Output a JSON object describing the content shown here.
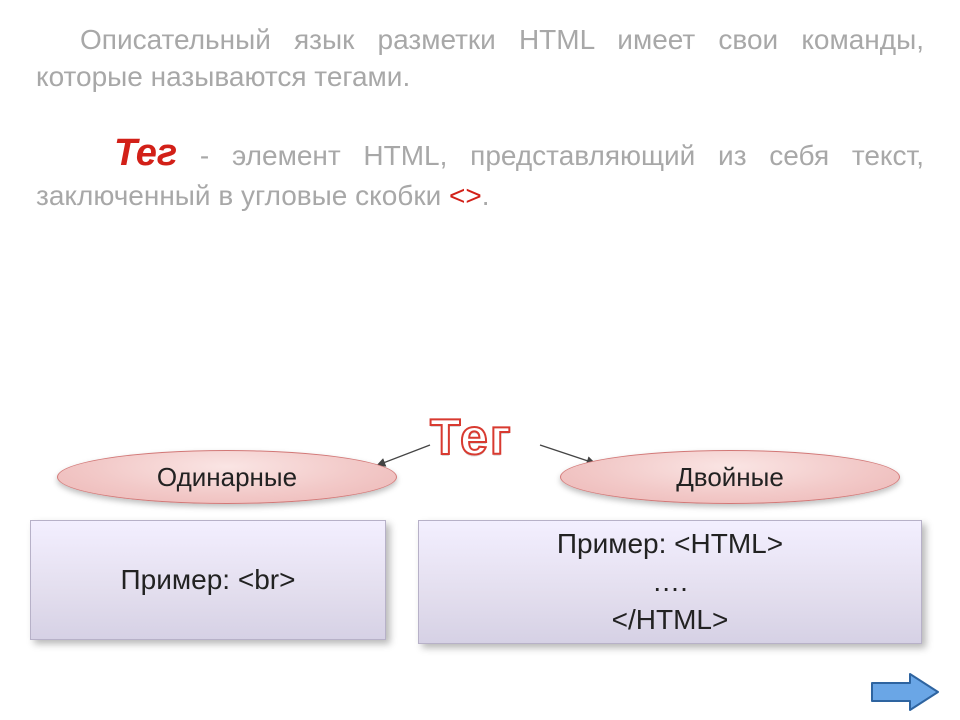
{
  "paragraph1": "Описательный язык разметки HTML имеет свои команды, которые называются тегами.",
  "definition": {
    "term": "Тег",
    "body_before": " - элемент HTML, представляющий из себя текст, заключенный в угловые скобки ",
    "angles": "<>",
    "body_after": "."
  },
  "teg_heading": "Тег",
  "ellipse_left": "Одинарные",
  "ellipse_right": "Двойные",
  "example_left": "Пример: <br>",
  "example_right": "Пример:  <HTML>\n….\n</HTML>",
  "colors": {
    "red": "#d22018",
    "grey": "#a8a8a8"
  }
}
